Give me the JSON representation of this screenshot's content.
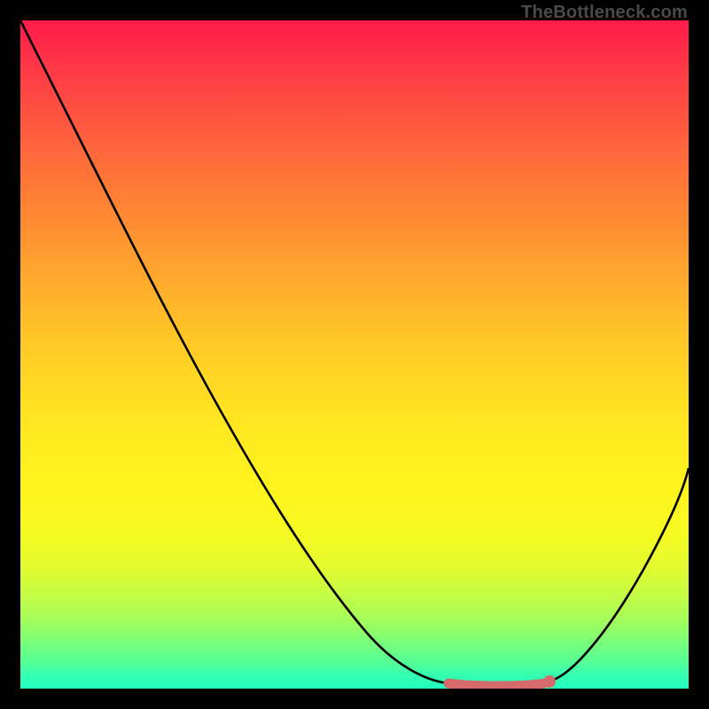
{
  "watermark": "TheBottleneck.com",
  "colors": {
    "gradient_top": "#ff1a4a",
    "gradient_mid": "#ffe820",
    "gradient_bottom": "#22ffc0",
    "curve": "#000000",
    "emphasis": "#d46a6a",
    "marker": "#d46a6a",
    "frame": "#000000"
  },
  "chart_data": {
    "type": "line",
    "title": "",
    "xlabel": "",
    "ylabel": "",
    "xlim": [
      0,
      100
    ],
    "ylim": [
      0,
      100
    ],
    "grid": false,
    "series": [
      {
        "name": "curve",
        "x": [
          0,
          5,
          10,
          15,
          20,
          25,
          30,
          35,
          40,
          45,
          50,
          55,
          60,
          63,
          66,
          69,
          72,
          75,
          78,
          82,
          86,
          90,
          94,
          97,
          100
        ],
        "values": [
          100,
          92,
          84,
          76,
          68,
          60,
          52,
          44,
          36,
          28,
          20,
          12,
          5,
          2.5,
          1.2,
          0.6,
          0.3,
          0.4,
          0.8,
          2.0,
          6,
          13,
          22,
          30,
          38
        ]
      }
    ],
    "emphasis_range_x": [
      63,
      78
    ],
    "marker": {
      "x": 78,
      "y": 0.8
    }
  }
}
